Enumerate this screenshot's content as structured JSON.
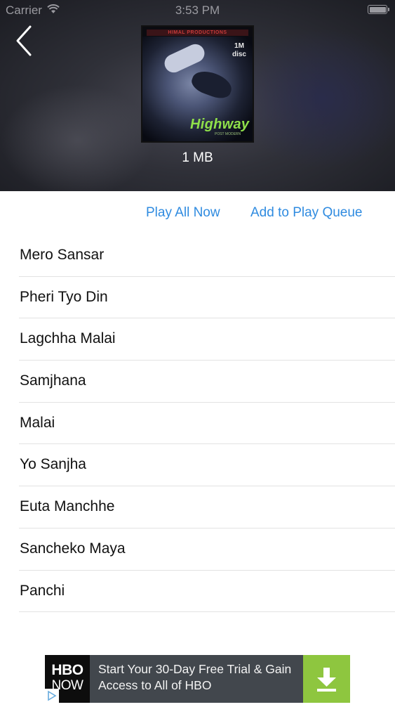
{
  "status_bar": {
    "carrier": "Carrier",
    "time": "3:53 PM"
  },
  "album": {
    "art_strip_text": "HIMAL PRODUCTIONS",
    "art_badge": "1M disc",
    "art_title": "Highway",
    "art_subtitle": "POST MODERN",
    "file_size": "1 MB"
  },
  "actions": {
    "play_all_label": "Play All Now",
    "add_queue_label": "Add to Play Queue"
  },
  "tracks": [
    {
      "title": "Mero Sansar"
    },
    {
      "title": "Pheri Tyo Din"
    },
    {
      "title": "Lagchha Malai"
    },
    {
      "title": "Samjhana"
    },
    {
      "title": "Malai"
    },
    {
      "title": "Yo Sanjha"
    },
    {
      "title": "Euta Manchhe"
    },
    {
      "title": "Sancheko Maya"
    },
    {
      "title": "Panchi"
    }
  ],
  "ad": {
    "logo_line1": "HBO",
    "logo_line2": "NOW",
    "text": "Start Your 30-Day Free Trial & Gain Access to All of HBO",
    "download_icon": "download-arrow-icon",
    "choices_icon": "ad-choices-icon"
  },
  "colors": {
    "accent": "#2f8be0",
    "ad_green": "#8ec63f",
    "ad_bg": "#42474d"
  }
}
